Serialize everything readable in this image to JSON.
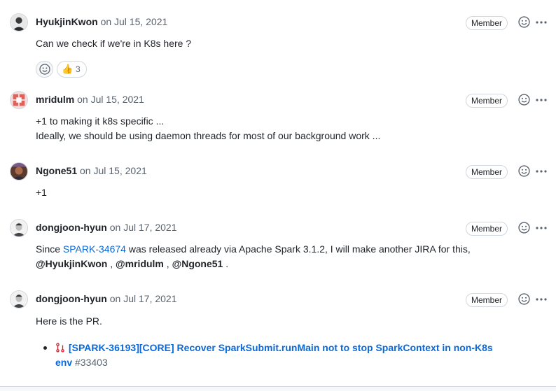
{
  "comments": [
    {
      "author": "HyukjinKwon",
      "date": "on Jul 15, 2021",
      "badge": "Member",
      "body": [
        "Can we check if we're in K8s here ?"
      ],
      "reactions": [
        {
          "emoji": "👍",
          "count": "3"
        }
      ]
    },
    {
      "author": "mridulm",
      "date": "on Jul 15, 2021",
      "badge": "Member",
      "body": [
        "+1 to making it k8s specific ...",
        "Ideally, we should be using daemon threads for most of our background work ..."
      ]
    },
    {
      "author": "Ngone51",
      "date": "on Jul 15, 2021",
      "badge": "Member",
      "body": [
        "+1"
      ]
    },
    {
      "author": "dongjoon-hyun",
      "date": "on Jul 17, 2021",
      "badge": "Member",
      "body_parts": {
        "prefix": "Since ",
        "link": "SPARK-34674",
        "suffix": " was released already via Apache Spark 3.1.2, I will make another JIRA for this,",
        "mention1": "@HyukjinKwon",
        "sep1": " , ",
        "mention2": "@mridulm",
        "sep2": " , ",
        "mention3": "@Ngone51",
        "end": " ."
      }
    },
    {
      "author": "dongjoon-hyun",
      "date": "on Jul 17, 2021",
      "badge": "Member",
      "body": [
        "Here is the PR."
      ],
      "pr": {
        "icon": "pull-request-icon",
        "title": "[SPARK-36193][CORE] Recover SparkSubmit.runMain not to stop SparkContext in non-K8s env",
        "number": "#33403"
      }
    }
  ],
  "colors": {
    "link": "#0969da",
    "muted": "#59636e",
    "border": "#d0d7de",
    "pr_icon": "#cf222e"
  }
}
